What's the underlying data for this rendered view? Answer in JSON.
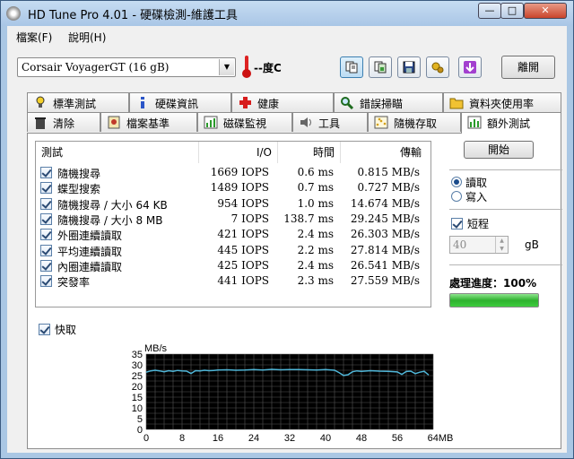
{
  "window": {
    "title": "HD Tune Pro 4.01 - 硬碟檢測-維護工具",
    "min_glyph": "—",
    "max_glyph": "□",
    "close_glyph": "✕"
  },
  "menu": {
    "file": "檔案(F)",
    "help": "說明(H)"
  },
  "toolbar": {
    "drive_name": "Corsair VoyagerGT      (16 gB)",
    "temperature": "--度C",
    "exit_label": "離開",
    "icons": [
      "copy-info-icon",
      "copy-screenshot-icon",
      "save-icon",
      "options-icon",
      "download-icon"
    ]
  },
  "tabs": {
    "row1": [
      "標準測試",
      "硬碟資訊",
      "健康",
      "錯誤掃瞄",
      "資料夾使用率"
    ],
    "row2": [
      "清除",
      "檔案基準",
      "磁碟監視",
      "工具",
      "隨機存取",
      "額外測試"
    ],
    "active": "額外測試"
  },
  "table": {
    "headers": {
      "test": "測試",
      "io": "I/O",
      "time": "時間",
      "transfer": "傳輸"
    },
    "rows": [
      {
        "name": "隨機搜尋",
        "io": "1669 IOPS",
        "time": "0.6 ms",
        "transfer": "0.815 MB/s"
      },
      {
        "name": "蝶型搜索",
        "io": "1489 IOPS",
        "time": "0.7 ms",
        "transfer": "0.727 MB/s"
      },
      {
        "name": "隨機搜尋 / 大小 64 KB",
        "io": "954 IOPS",
        "time": "1.0 ms",
        "transfer": "14.674 MB/s"
      },
      {
        "name": "隨機搜尋 / 大小 8 MB",
        "io": "7 IOPS",
        "time": "138.7 ms",
        "transfer": "29.245 MB/s"
      },
      {
        "name": "外圈連續讀取",
        "io": "421 IOPS",
        "time": "2.4 ms",
        "transfer": "26.303 MB/s"
      },
      {
        "name": "平均連續讀取",
        "io": "445 IOPS",
        "time": "2.2 ms",
        "transfer": "27.814 MB/s"
      },
      {
        "name": "內圈連續讀取",
        "io": "425 IOPS",
        "time": "2.4 ms",
        "transfer": "26.541 MB/s"
      },
      {
        "name": "突發率",
        "io": "441 IOPS",
        "time": "2.3 ms",
        "transfer": "27.559 MB/s"
      }
    ]
  },
  "side": {
    "start_label": "開始",
    "read_label": "讀取",
    "write_label": "寫入",
    "short_label": "短程",
    "size_value": "40",
    "size_unit": "gB",
    "progress_label": "處理進度：",
    "progress_value": "100%",
    "progress_fraction": 1.0
  },
  "cache_label": "快取",
  "chart_data": {
    "type": "line",
    "ylabel": "MB/s",
    "xlabel": "",
    "xlim": [
      0,
      64
    ],
    "ylim": [
      0,
      35
    ],
    "x_ticks": [
      "0",
      "8",
      "16",
      "24",
      "32",
      "40",
      "48",
      "56",
      "64MB"
    ],
    "y_ticks": [
      "35",
      "30",
      "25",
      "20",
      "15",
      "10",
      "5",
      "0"
    ],
    "x": [
      0,
      1,
      2,
      3,
      4,
      5,
      6,
      7,
      8,
      9,
      10,
      11,
      12,
      13,
      14,
      15,
      16,
      18,
      20,
      22,
      24,
      26,
      28,
      30,
      32,
      34,
      36,
      38,
      40,
      42,
      43,
      44,
      45,
      46,
      47,
      48,
      50,
      52,
      54,
      56,
      57,
      58,
      59,
      60,
      61,
      62,
      63
    ],
    "y": [
      26.6,
      27.2,
      27.5,
      27.2,
      26.8,
      27.3,
      27.0,
      27.4,
      27.2,
      27.1,
      26.0,
      27.3,
      27.2,
      27.5,
      27.3,
      27.4,
      27.6,
      27.7,
      27.5,
      27.6,
      27.8,
      27.6,
      27.9,
      27.7,
      27.8,
      27.8,
      27.7,
      27.6,
      27.8,
      27.5,
      26.4,
      25.1,
      25.4,
      26.8,
      27.2,
      27.0,
      27.3,
      27.1,
      27.0,
      26.7,
      25.6,
      26.9,
      27.1,
      25.9,
      26.6,
      27.0,
      25.3
    ],
    "grid": true,
    "background": "#000000",
    "line_color": "#4fb6d8",
    "grid_color": "#555555"
  }
}
